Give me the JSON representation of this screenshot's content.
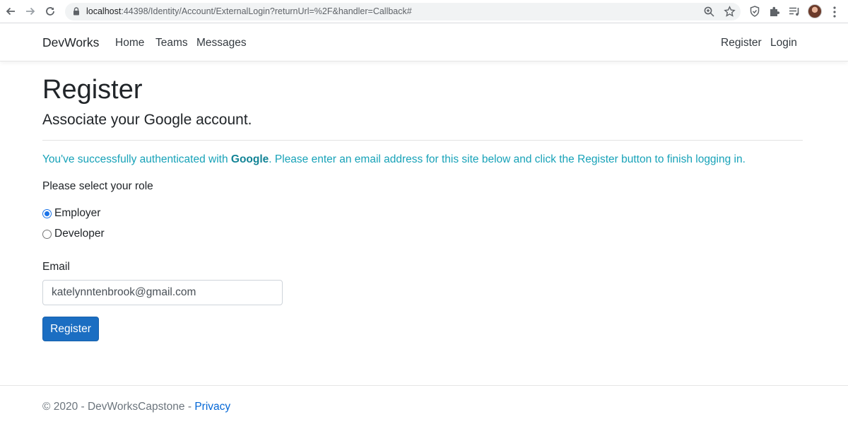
{
  "browser": {
    "url_host": "localhost",
    "url_rest": ":44398/Identity/Account/ExternalLogin?returnUrl=%2F&handler=Callback#"
  },
  "navbar": {
    "brand": "DevWorks",
    "left_links": [
      "Home",
      "Teams",
      "Messages"
    ],
    "right_links": [
      "Register",
      "Login"
    ]
  },
  "page": {
    "title": "Register",
    "subtitle": "Associate your Google account.",
    "info_prefix": "You've successfully authenticated with ",
    "info_provider": "Google",
    "info_suffix": ". Please enter an email address for this site below and click the Register button to finish logging in.",
    "role_label": "Please select your role",
    "roles": [
      {
        "label": "Employer",
        "checked": true
      },
      {
        "label": "Developer",
        "checked": false
      }
    ],
    "email_label": "Email",
    "email_value": "katelynntenbrook@gmail.com",
    "submit_label": "Register"
  },
  "footer": {
    "text": "© 2020 - DevWorksCapstone - ",
    "privacy_link": "Privacy"
  },
  "colors": {
    "primary_button": "#1b6ec2",
    "info_text": "#17a2b8",
    "link": "#0366d6"
  }
}
